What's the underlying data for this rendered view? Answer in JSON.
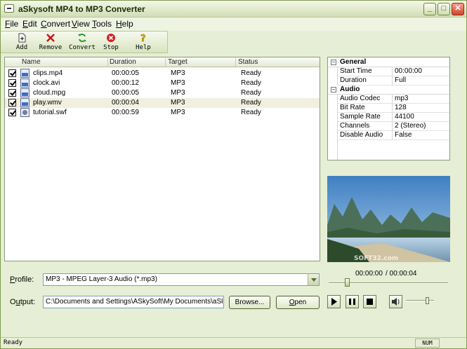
{
  "window": {
    "title": "aSkysoft MP4 to MP3 Converter"
  },
  "menu": [
    {
      "u": "F",
      "rest": "ile"
    },
    {
      "u": "E",
      "rest": "dit"
    },
    {
      "u": "C",
      "rest": "onvert"
    },
    {
      "u": "V",
      "rest": "iew"
    },
    {
      "u": "T",
      "rest": "ools"
    },
    {
      "u": "H",
      "rest": "elp"
    }
  ],
  "toolbar": {
    "add": "Add",
    "remove": "Remove",
    "convert": "Convert",
    "stop": "Stop",
    "help": "Help"
  },
  "list": {
    "columns": {
      "name": "Name",
      "duration": "Duration",
      "target": "Target",
      "status": "Status"
    },
    "rows": [
      {
        "name": "clips.mp4",
        "duration": "00:00:05",
        "target": "MP3",
        "status": "Ready"
      },
      {
        "name": "clock.avi",
        "duration": "00:00:12",
        "target": "MP3",
        "status": "Ready"
      },
      {
        "name": "cloud.mpg",
        "duration": "00:00:05",
        "target": "MP3",
        "status": "Ready"
      },
      {
        "name": "play.wmv",
        "duration": "00:00:04",
        "target": "MP3",
        "status": "Ready"
      },
      {
        "name": "tutorial.swf",
        "duration": "00:00:59",
        "target": "MP3",
        "status": "Ready"
      }
    ]
  },
  "props": {
    "general": "General",
    "start_time_k": "Start Time",
    "start_time_v": "00:00:00",
    "duration_k": "Duration",
    "duration_v": "Full",
    "audio": "Audio",
    "codec_k": "Audio Codec",
    "codec_v": "mp3",
    "bitrate_k": "Bit Rate",
    "bitrate_v": "128",
    "sample_k": "Sample Rate",
    "sample_v": "44100",
    "channels_k": "Channels",
    "channels_v": "2 (Stereo)",
    "disable_k": "Disable Audio",
    "disable_v": "False"
  },
  "preview": {
    "watermark": "SOFT32.com",
    "current": "00:00:00",
    "total": "/ 00:00:04"
  },
  "profile": {
    "label_u": "P",
    "label_rest": "rofile:",
    "value": "MP3 - MPEG Layer-3 Audio (*.mp3)"
  },
  "output": {
    "label_u": "u",
    "label_pre": "O",
    "label_rest": "tput:",
    "value": "C:\\Documents and Settings\\ASkySoft\\My Documents\\aSkysoft",
    "browse": "Browse...",
    "open_u": "O",
    "open_rest": "pen"
  },
  "status": {
    "text": "Ready",
    "num": "NUM"
  }
}
